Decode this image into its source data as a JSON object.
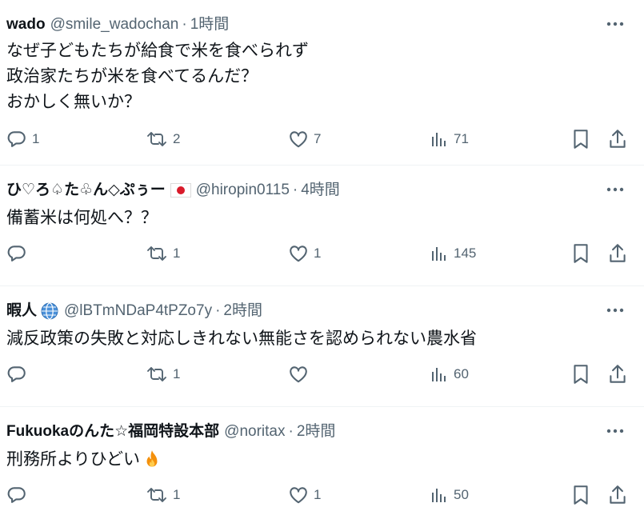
{
  "tweets": [
    {
      "author": "wado",
      "handle": "@smile_wadochan",
      "separator": "·",
      "time": "1時間",
      "text": "なぜ子どもたちが給食で米を食べられず\n政治家たちが米を食べてるんだ？\nおかしく無いか？",
      "replies": "1",
      "retweets": "2",
      "likes": "7",
      "views": "71"
    },
    {
      "author": "ひ♡ろ♤た♧ん◇ぷぅー",
      "author_flag_icon": "japan-flag-icon",
      "handle": "@hiropin0115",
      "separator": "·",
      "time": "4時間",
      "text": "備蓄米は何処へ？？",
      "replies": "",
      "retweets": "1",
      "likes": "1",
      "views": "145"
    },
    {
      "author": "暇人",
      "author_badge_icon": "globe-icon",
      "handle": "@lBTmNDaP4tPZo7y",
      "separator": "·",
      "time": "2時間",
      "text": "減反政策の失敗と対応しきれない無能さを認められない農水省",
      "replies": "",
      "retweets": "1",
      "likes": "",
      "views": "60"
    },
    {
      "author": "Fukuokaのんた☆福岡特設本部",
      "handle": "@noritax",
      "separator": "·",
      "time": "2時間",
      "text": "刑務所よりひどい",
      "text_emoji_icon": "fire-icon",
      "replies": "",
      "retweets": "1",
      "likes": "1",
      "views": "50"
    }
  ],
  "icons": {
    "more": "more-horizontal-icon",
    "reply": "reply-bubble-icon",
    "retweet": "retweet-icon",
    "like": "heart-icon",
    "views": "bar-chart-icon",
    "bookmark": "bookmark-icon",
    "share": "share-icon"
  },
  "colors": {
    "text": "#0f1419",
    "secondary": "#536471",
    "divider": "#eff3f4"
  }
}
